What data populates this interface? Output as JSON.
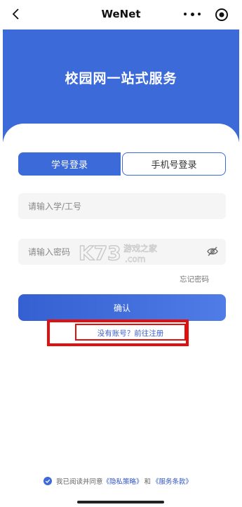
{
  "nav": {
    "title": "WeNet",
    "back_icon": "chevron-left-icon",
    "more_icon": "more-dots-icon",
    "close_icon": "target-close-icon"
  },
  "hero": {
    "title": "校园网一站式服务"
  },
  "tabs": {
    "student": "学号登录",
    "phone": "手机号登录"
  },
  "form": {
    "id_placeholder": "请输入学/工号",
    "password_placeholder": "请输入密码",
    "forgot": "忘记密码",
    "confirm": "确认",
    "register": "没有账号？前往注册"
  },
  "watermark": {
    "main": "K73",
    "cn": "游戏之家",
    "sub": ".com"
  },
  "agreement": {
    "prefix": "我已阅读并同意",
    "privacy": "《隐私策略》",
    "and": "和",
    "terms": "《服务条款》"
  },
  "colors": {
    "primary": "#3d6ad9",
    "highlight_box": "#e0100f",
    "link": "#3d5fc9"
  }
}
